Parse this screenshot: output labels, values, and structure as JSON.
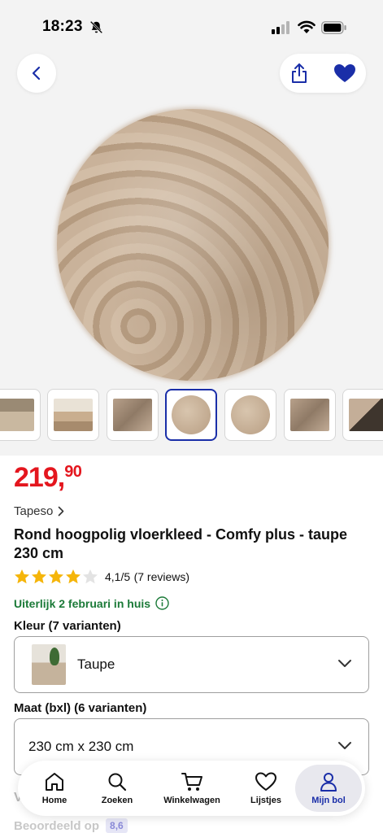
{
  "status_bar": {
    "time": "18:23"
  },
  "product": {
    "price_main": "219,",
    "price_cents": "90",
    "brand": "Tapeso",
    "title": "Rond hoogpolig vloerkleed - Comfy plus - taupe 230 cm",
    "rating_value": "4,1/5",
    "rating_reviews": "(7 reviews)",
    "stars": 4.1,
    "delivery": "Uiterlijk 2 februari in huis"
  },
  "variants": {
    "kleur_label": "Kleur (7 varianten)",
    "kleur_value": "Taupe",
    "maat_label": "Maat (bxl) (6 varianten)",
    "maat_value": "230 cm x 230 cm"
  },
  "faded": {
    "v": "V",
    "beoordeeld": "Beoordeeld op",
    "score": "8,6"
  },
  "nav": {
    "items": [
      {
        "label": "Home",
        "icon": "home-icon"
      },
      {
        "label": "Zoeken",
        "icon": "search-icon"
      },
      {
        "label": "Winkelwagen",
        "icon": "cart-icon"
      },
      {
        "label": "Lijstjes",
        "icon": "heart-outline-icon"
      },
      {
        "label": "Mijn bol",
        "icon": "user-icon"
      }
    ],
    "active": "Mijn bol"
  },
  "colors": {
    "price": "#e4161e",
    "accent": "#1a2ea8",
    "delivery": "#1b7a38"
  }
}
